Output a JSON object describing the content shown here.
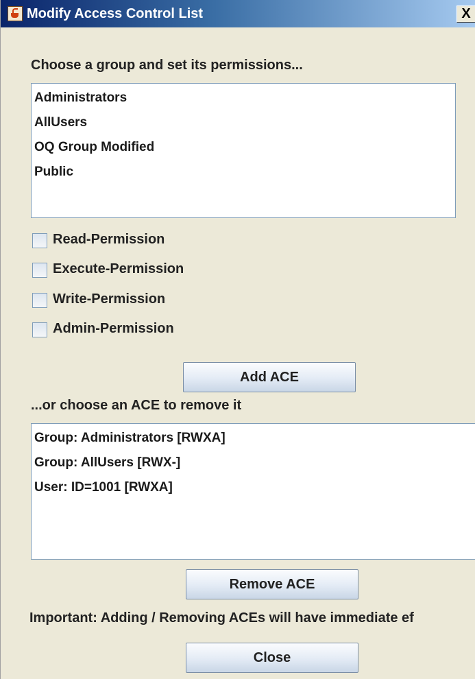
{
  "window": {
    "title": "Modify Access Control List",
    "close_glyph": "X"
  },
  "groups_section": {
    "prompt": "Choose a group and set its permissions...",
    "groups": [
      "Administrators",
      "AllUsers",
      "OQ Group Modified",
      "Public"
    ]
  },
  "permissions": [
    {
      "label": "Read-Permission",
      "checked": false
    },
    {
      "label": "Execute-Permission",
      "checked": false
    },
    {
      "label": "Write-Permission",
      "checked": false
    },
    {
      "label": "Admin-Permission",
      "checked": false
    }
  ],
  "add_button": "Add ACE",
  "ace_section": {
    "prompt": "...or choose an ACE to remove it",
    "aces": [
      "Group: Administrators [RWXA]",
      "Group: AllUsers [RWX-]",
      "User: ID=1001 [RWXA]"
    ]
  },
  "remove_button": "Remove ACE",
  "notice": "Important: Adding / Removing ACEs will have immediate ef",
  "close_button": "Close",
  "icons": {
    "app": "java-cup-icon",
    "close": "close-icon"
  }
}
